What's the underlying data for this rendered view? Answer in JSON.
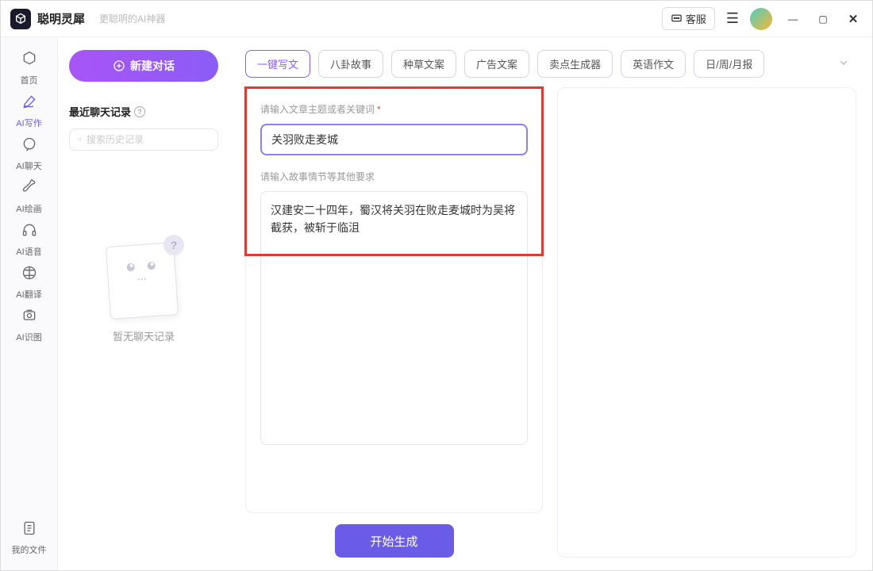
{
  "titlebar": {
    "logo_text": "聪明灵犀",
    "tagline": "更聪明的AI神器",
    "support_label": "客服"
  },
  "nav": {
    "items": [
      {
        "label": "首页",
        "icon": "home"
      },
      {
        "label": "AI写作",
        "icon": "pen"
      },
      {
        "label": "AI聊天",
        "icon": "chat"
      },
      {
        "label": "AI绘画",
        "icon": "brush"
      },
      {
        "label": "AI语音",
        "icon": "headphone"
      },
      {
        "label": "AI翻译",
        "icon": "translate"
      },
      {
        "label": "AI识图",
        "icon": "image"
      }
    ],
    "myfiles_label": "我的文件"
  },
  "sidebar": {
    "new_chat_label": "新建对话",
    "recent_header": "最近聊天记录",
    "search_placeholder": "搜索历史记录",
    "empty_text": "暂无聊天记录"
  },
  "tabs": {
    "items": [
      "一键写文",
      "八卦故事",
      "种草文案",
      "广告文案",
      "卖点生成器",
      "英语作文",
      "日/周/月报"
    ],
    "active_index": 0
  },
  "form": {
    "topic_label": "请输入文章主题或者关键词",
    "topic_value": "关羽败走麦城",
    "details_label": "请输入故事情节等其他要求",
    "details_value": "汉建安二十四年，蜀汉将关羽在败走麦城时为吴将截获，被斩于临沮",
    "generate_label": "开始生成"
  }
}
